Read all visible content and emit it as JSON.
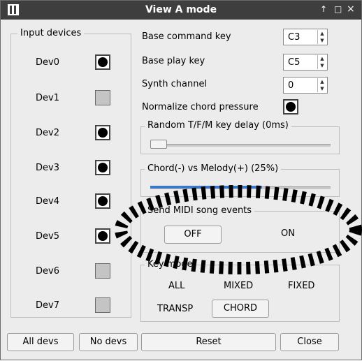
{
  "window": {
    "title": "View A mode",
    "title_buttons": [
      "↑",
      "□",
      "×"
    ]
  },
  "input_devices": {
    "title": "Input devices",
    "devices": [
      {
        "label": "Dev0",
        "checked": true
      },
      {
        "label": "Dev1",
        "checked": false
      },
      {
        "label": "Dev2",
        "checked": true
      },
      {
        "label": "Dev3",
        "checked": true
      },
      {
        "label": "Dev4",
        "checked": true
      },
      {
        "label": "Dev5",
        "checked": true
      },
      {
        "label": "Dev6",
        "checked": false
      },
      {
        "label": "Dev7",
        "checked": false
      }
    ],
    "all_label": "All devs",
    "none_label": "No devs"
  },
  "settings": {
    "base_command_key": {
      "label": "Base command key",
      "value": "C3"
    },
    "base_play_key": {
      "label": "Base play key",
      "value": "C5"
    },
    "synth_channel": {
      "label": "Synth channel",
      "value": "0"
    },
    "normalize": {
      "label": "Normalize chord pressure",
      "checked": true
    },
    "random_delay": {
      "title": "Random T/F/M key delay (0ms)",
      "value_ms": 0
    },
    "chord_melody": {
      "title": "Chord(-) vs Melody(+) (25%)",
      "percent": 25
    },
    "midi_song": {
      "title": "Send MIDI song events",
      "off_label": "OFF",
      "on_label": "ON",
      "selected": "OFF"
    },
    "key_mode": {
      "title": "Key mode",
      "options": [
        "ALL",
        "MIXED",
        "FIXED"
      ],
      "transp_label": "TRANSP",
      "chord_label": "CHORD",
      "selected": "CHORD"
    },
    "reset_label": "Reset",
    "close_label": "Close"
  },
  "colors": {
    "titlebar": "#3e3e3e",
    "window_bg": "#ececec",
    "slider_fill": "#3d77c8"
  }
}
